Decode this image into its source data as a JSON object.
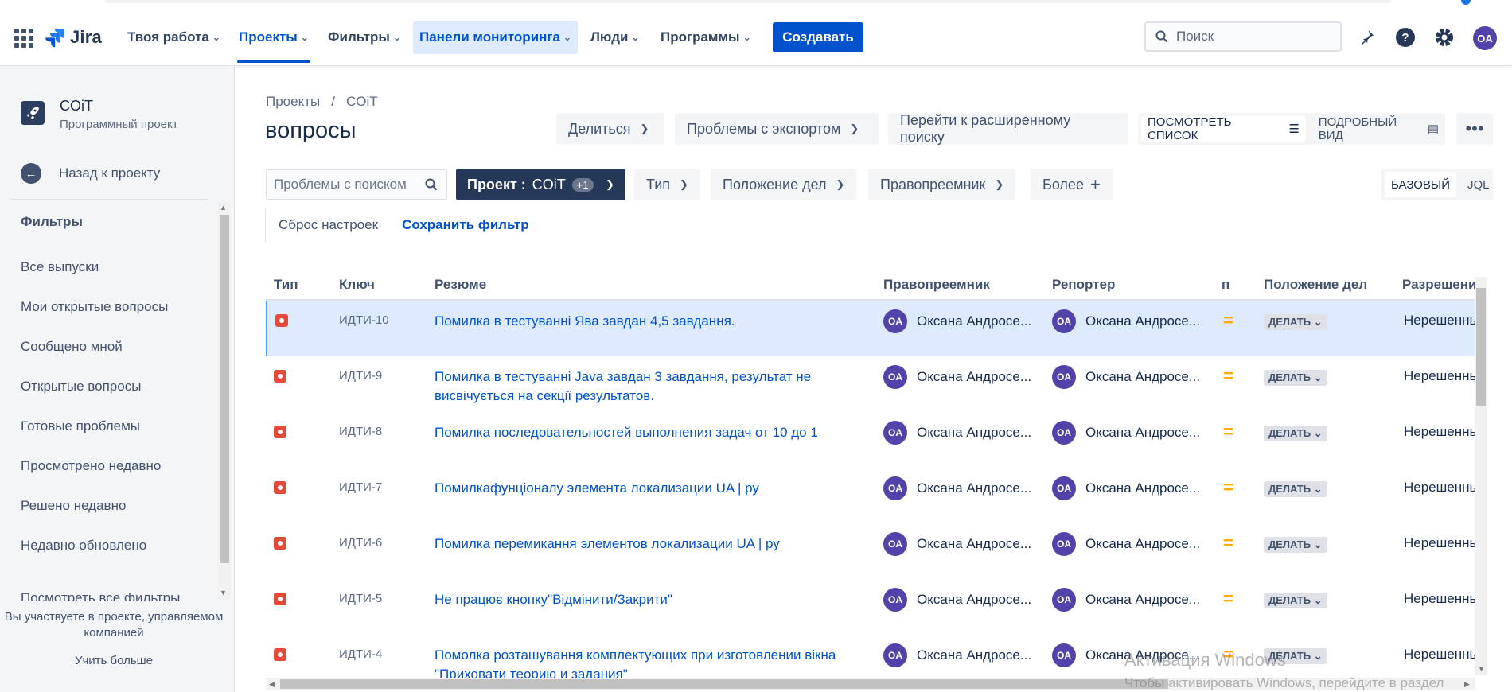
{
  "nav": {
    "logo": "Jira",
    "items": [
      {
        "label": "Твоя работа"
      },
      {
        "label": "Проекты"
      },
      {
        "label": "Фильтры"
      },
      {
        "label": "Панели мониторинга"
      },
      {
        "label": "Люди"
      },
      {
        "label": "Программы"
      }
    ],
    "create_label": "Создавать",
    "search_placeholder": "Поиск",
    "user_initials": "OA"
  },
  "sidebar": {
    "project_name": "COiT",
    "project_type": "Программный проект",
    "back_label": "Назад к проекту",
    "filters_heading": "Фильтры",
    "items": [
      {
        "label": "Все выпуски"
      },
      {
        "label": "Мои открытые вопросы"
      },
      {
        "label": "Сообщено мной"
      },
      {
        "label": "Открытые вопросы"
      },
      {
        "label": "Готовые проблемы"
      },
      {
        "label": "Просмотрено недавно"
      },
      {
        "label": "Решено недавно"
      },
      {
        "label": "Недавно обновлено"
      }
    ],
    "cut_item": "Посмотреть все фильтры",
    "footer_text": "Вы участвуете в проекте, управляемом компанией",
    "learn_more": "Учить больше"
  },
  "main": {
    "breadcrumb": [
      "Проекты",
      "/",
      "COiT"
    ],
    "title": "вопросы",
    "toolbar": {
      "share": "Делиться",
      "export": "Проблемы с экспортом",
      "advanced": "Перейти к расширенному поиску",
      "list_view": "ПОСМОТРЕТЬ СПИСОК",
      "detail_view": "ПОДРОБНЫЙ ВИД",
      "more": "•••"
    },
    "filters": {
      "search_placeholder": "Проблемы с поиском",
      "project_label": "Проект :",
      "project_value": "COiT",
      "project_badge": "+1",
      "type": "Тип",
      "status": "Положение дел",
      "assignee": "Правопреемник",
      "more": "Более",
      "basic": "БАЗОВЫЙ",
      "jql": "JQL",
      "reset": "Сброс настроек",
      "save": "Сохранить фильтр"
    },
    "table": {
      "headers": {
        "type": "Тип",
        "key": "Ключ",
        "summary": "Резюме",
        "assignee": "Правопреемник",
        "reporter": "Репортер",
        "priority": "п",
        "status": "Положение дел",
        "resolution": "Разрешение"
      },
      "rows": [
        {
          "key": "ИДТИ-10",
          "summary": "Помилка в тестуванні Ява завдан 4,5 завдання.",
          "assignee": "Оксана Андросе...",
          "reporter": "Оксана Андросе...",
          "priority": "=",
          "status": "ДЕЛАТЬ",
          "resolution": "Нерешенные"
        },
        {
          "key": "ИДТИ-9",
          "summary": "Помилка в тестуванні Java завдан 3 завдання, результат не висвічується на секції результатов.",
          "assignee": "Оксана Андросе...",
          "reporter": "Оксана Андросе...",
          "priority": "=",
          "status": "ДЕЛАТЬ",
          "resolution": "Нерешенные"
        },
        {
          "key": "ИДТИ-8",
          "summary": "Помилка последовательностей выполнения задач от 10 до 1",
          "assignee": "Оксана Андросе...",
          "reporter": "Оксана Андросе...",
          "priority": "=",
          "status": "ДЕЛАТЬ",
          "resolution": "Нерешенные"
        },
        {
          "key": "ИДТИ-7",
          "summary": "Помилкафунціоналу элемента локализации UA | ру",
          "assignee": "Оксана Андросе...",
          "reporter": "Оксана Андросе...",
          "priority": "=",
          "status": "ДЕЛАТЬ",
          "resolution": "Нерешенные"
        },
        {
          "key": "ИДТИ-6",
          "summary": "Помилка перемикання элементов локализации UA | ру",
          "assignee": "Оксана Андросе...",
          "reporter": "Оксана Андросе...",
          "priority": "=",
          "status": "ДЕЛАТЬ",
          "resolution": "Нерешенные"
        },
        {
          "key": "ИДТИ-5",
          "summary": "Не працює кнопку\"Відмінити/Закрити\"",
          "assignee": "Оксана Андросе...",
          "reporter": "Оксана Андросе...",
          "priority": "=",
          "status": "ДЕЛАТЬ",
          "resolution": "Нерешенные"
        },
        {
          "key": "ИДТИ-4",
          "summary": "Помолка розташування комплектующих при изготовлении вікна \"Приховати теорию и задания\"",
          "assignee": "Оксана Андросе...",
          "reporter": "Оксана Андросе...",
          "priority": "=",
          "status": "ДЕЛАТЬ",
          "resolution": "Нерешенные"
        }
      ]
    }
  },
  "watermark": {
    "line1": "Активация Windows",
    "line2": "Чтобы активировать Windows, перейдите в раздел"
  },
  "colors": {
    "primary": "#0052cc",
    "nav_dark": "#253858",
    "bug": "#e5493a",
    "avatar": "#5243aa",
    "priority_medium": "#ffab00",
    "row_selected": "#deebff"
  }
}
